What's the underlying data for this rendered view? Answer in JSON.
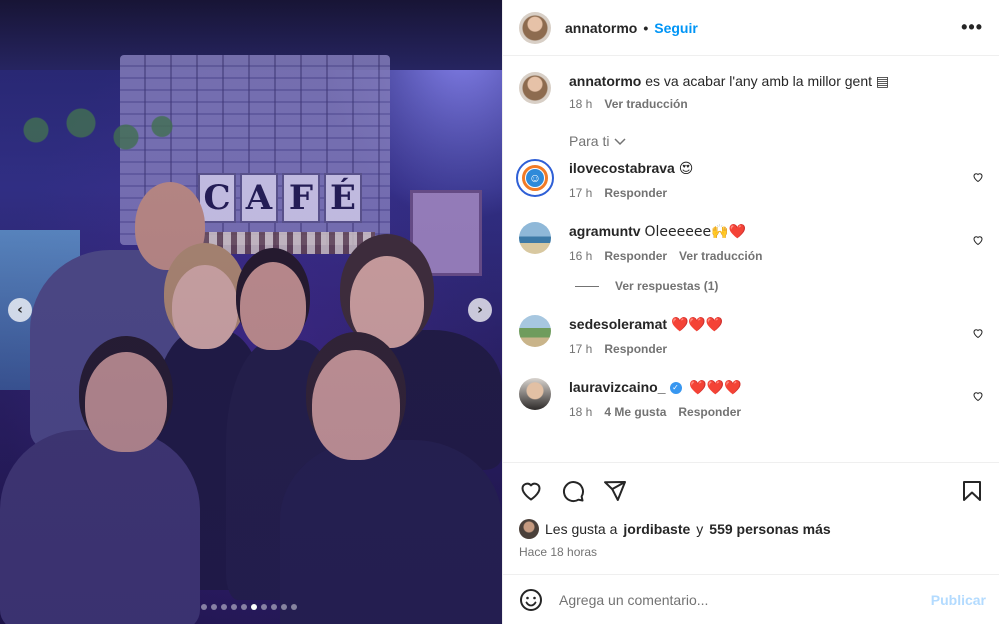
{
  "post": {
    "username": "annatormo",
    "follow_label": "Seguir",
    "more_icon": "more-horizontal-icon",
    "caption": {
      "username": "annatormo",
      "text": "es va acabar l'any amb la millor gent",
      "emoji": "▤",
      "time": "18 h",
      "translate": "Ver traducción"
    },
    "sort_label": "Para ti",
    "image": {
      "sign_letters": [
        "C",
        "A",
        "F",
        "É"
      ],
      "carousel_dots": 10,
      "active_dot": 5
    }
  },
  "comments": [
    {
      "username": "ilovecostabrava",
      "text": "😍",
      "time": "17 h",
      "reply": "Responder"
    },
    {
      "username": "agramuntv",
      "text": "Oleeeeee🙌❤️",
      "time": "16 h",
      "reply": "Responder",
      "translate": "Ver traducción",
      "view_replies": "Ver respuestas (1)"
    },
    {
      "username": "sedesoleramat",
      "text": "❤️❤️❤️",
      "time": "17 h",
      "reply": "Responder"
    },
    {
      "username": "lauravizcaino_",
      "text": "❤️❤️❤️",
      "time": "18 h",
      "likes": "4 Me gusta",
      "reply": "Responder",
      "verified": true
    }
  ],
  "actions": {
    "likes_prefix": "Les gusta a",
    "liked_by": "jordibaste",
    "and": "y",
    "others": "559 personas más",
    "time_ago": "Hace 18 horas"
  },
  "composer": {
    "placeholder": "Agrega un comentario...",
    "publish": "Publicar"
  },
  "colors": {
    "accent": "#0095f6",
    "publish_disabled": "#b3dbff",
    "muted": "#737373"
  }
}
